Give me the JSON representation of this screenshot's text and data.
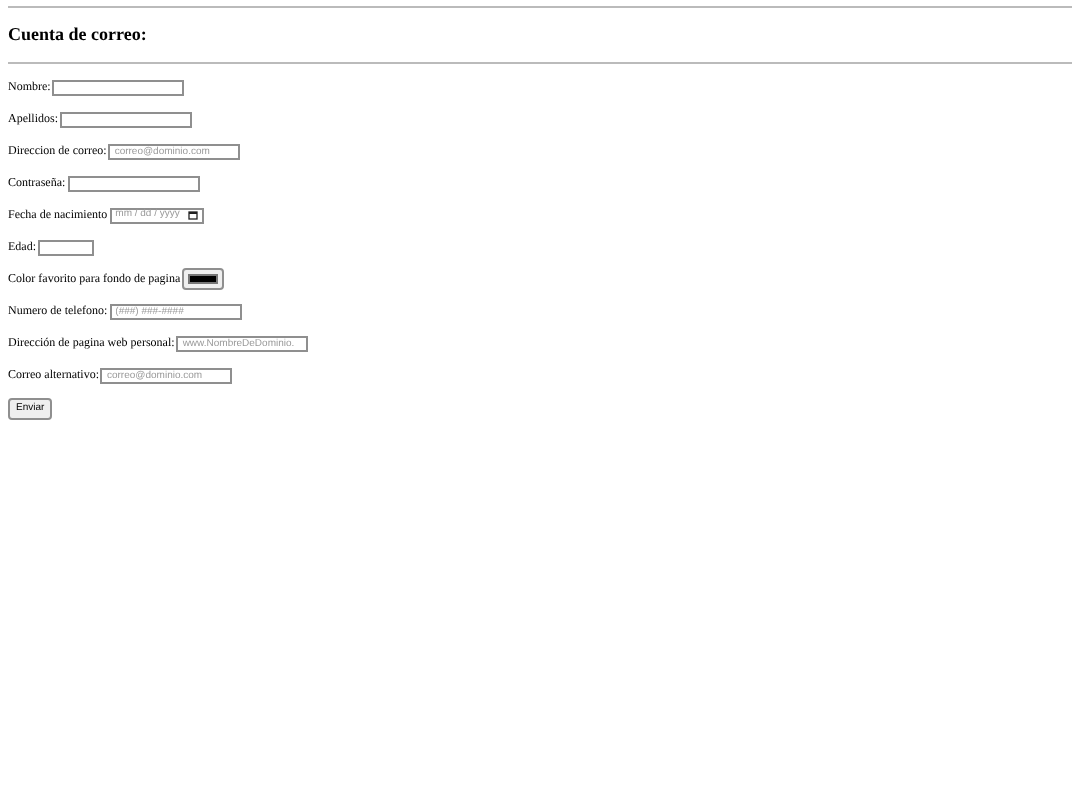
{
  "heading": "Cuenta de correo:",
  "fields": [
    {
      "label": "Nombre:",
      "kind": "text"
    },
    {
      "label": "Apellidos:",
      "kind": "text"
    },
    {
      "label": "Direccion de correo:",
      "kind": "text",
      "placeholder": "correo@dominio.com"
    },
    {
      "label": "Contraseña:",
      "kind": "text"
    },
    {
      "label": "Fecha de nacimiento",
      "kind": "date",
      "placeholder": "mm / dd / yyyy"
    },
    {
      "label": "Edad:",
      "kind": "short"
    },
    {
      "label": "Color favorito para fondo de pagina",
      "kind": "color",
      "color": "#000000"
    },
    {
      "label": "Numero de telefono:",
      "kind": "text",
      "placeholder": "(###) ###-####"
    },
    {
      "label": "Dirección de pagina web personal:",
      "kind": "text",
      "placeholder": "www.NombreDeDominio."
    },
    {
      "label": "Correo alternativo:",
      "kind": "text",
      "placeholder": "correo@dominio.com"
    }
  ],
  "submit": "Enviar"
}
